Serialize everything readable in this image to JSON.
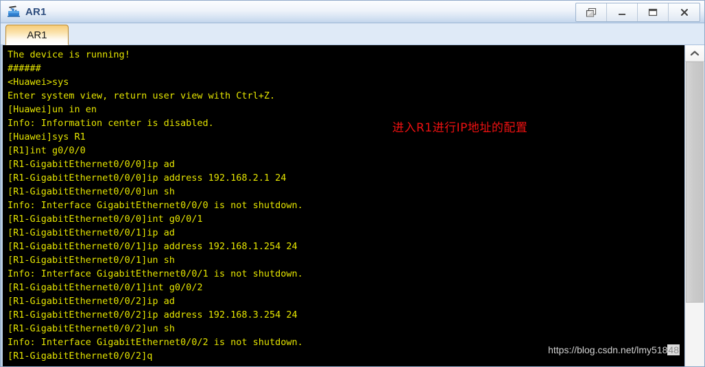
{
  "window": {
    "title": "AR1",
    "icon": "router-icon",
    "controls": [
      {
        "name": "restore-button",
        "glyph": "cascade-icon",
        "label": "Restore"
      },
      {
        "name": "minimize-button",
        "glyph": "minimize-icon",
        "label": "Minimize"
      },
      {
        "name": "maximize-button",
        "glyph": "maximize-icon",
        "label": "Maximize"
      },
      {
        "name": "close-button",
        "glyph": "close-icon",
        "label": "X"
      }
    ]
  },
  "tabs": [
    {
      "label": "AR1",
      "active": true
    }
  ],
  "terminal": {
    "foreground_color": "#e5e500",
    "background_color": "#000000",
    "lines": [
      "The device is running!",
      "######",
      "<Huawei>sys",
      "Enter system view, return user view with Ctrl+Z.",
      "[Huawei]un in en",
      "Info: Information center is disabled.",
      "[Huawei]sys R1",
      "[R1]int g0/0/0",
      "[R1-GigabitEthernet0/0/0]ip ad",
      "[R1-GigabitEthernet0/0/0]ip address 192.168.2.1 24",
      "[R1-GigabitEthernet0/0/0]un sh",
      "Info: Interface GigabitEthernet0/0/0 is not shutdown.",
      "[R1-GigabitEthernet0/0/0]int g0/0/1",
      "[R1-GigabitEthernet0/0/1]ip ad",
      "[R1-GigabitEthernet0/0/1]ip address 192.168.1.254 24",
      "[R1-GigabitEthernet0/0/1]un sh",
      "Info: Interface GigabitEthernet0/0/1 is not shutdown.",
      "[R1-GigabitEthernet0/0/1]int g0/0/2",
      "[R1-GigabitEthernet0/0/2]ip ad",
      "[R1-GigabitEthernet0/0/2]ip address 192.168.3.254 24",
      "[R1-GigabitEthernet0/0/2]un sh",
      "Info: Interface GigabitEthernet0/0/2 is not shutdown.",
      "[R1-GigabitEthernet0/0/2]q"
    ]
  },
  "annotation": {
    "text": "进入R1进行IP地址的配置",
    "color": "#ee1111"
  },
  "watermark": {
    "text": "https://blog.csdn.net/lmy518",
    "suffix": "48"
  },
  "scrollbar": {
    "up_arrow": "chevron-up-icon"
  }
}
